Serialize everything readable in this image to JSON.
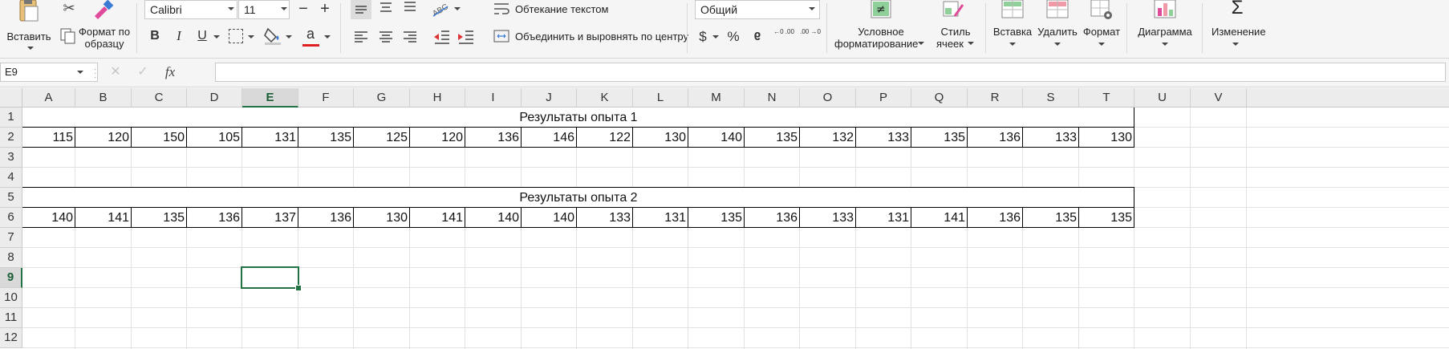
{
  "ribbon": {
    "paste_label": "Вставить",
    "format_painter_label1": "Формат по",
    "format_painter_label2": "образцу",
    "font_name": "Calibri",
    "font_size": "11",
    "wrap_text_label": "Обтекание текстом",
    "merge_center_label": "Объединить и выровнять по центру",
    "number_format": "Общий",
    "cond_format_label1": "Условное",
    "cond_format_label2": "форматирование",
    "cell_style_label1": "Стиль",
    "cell_style_label2": "ячеек",
    "insert_label": "Вставка",
    "delete_label": "Удалить",
    "format_label": "Формат",
    "chart_label": "Диаграмма",
    "edit_label": "Изменение",
    "bold": "B",
    "italic": "I",
    "underline": "U",
    "font_color_glyph": "a",
    "currency": "$",
    "percent": "%",
    "comma": "9",
    "inc_decimal": "←0 .00",
    "dec_decimal": ".00 →0",
    "grow_font": "+",
    "shrink_font": "−",
    "accent_color": "#217346",
    "font_color": "#e02020"
  },
  "formula_bar": {
    "name_box": "E9",
    "fx": "fx",
    "cancel": "✕",
    "confirm": "✓",
    "content": ""
  },
  "sheet": {
    "columns": [
      "A",
      "B",
      "C",
      "D",
      "E",
      "F",
      "G",
      "H",
      "I",
      "J",
      "K",
      "L",
      "M",
      "N",
      "O",
      "P",
      "Q",
      "R",
      "S",
      "T",
      "U",
      "V"
    ],
    "rows": [
      "1",
      "2",
      "3",
      "4",
      "5",
      "6",
      "7",
      "8",
      "9",
      "10",
      "11",
      "12"
    ],
    "selected_cell": "E9",
    "title1": "Результаты опыта 1",
    "title2": "Результаты опыта 2",
    "row2": [
      115,
      120,
      150,
      105,
      131,
      135,
      125,
      120,
      136,
      146,
      122,
      130,
      140,
      135,
      132,
      133,
      135,
      136,
      133,
      130
    ],
    "row6": [
      140,
      141,
      135,
      136,
      137,
      136,
      130,
      141,
      140,
      140,
      133,
      131,
      135,
      136,
      133,
      131,
      141,
      136,
      135,
      135
    ]
  }
}
